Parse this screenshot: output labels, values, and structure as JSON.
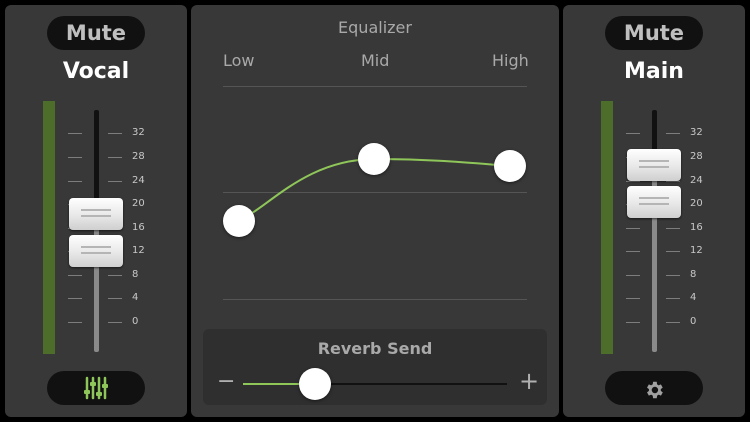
{
  "left_channel": {
    "mute_label": "Mute",
    "name": "Vocal",
    "scale": [
      "32",
      "28",
      "24",
      "20",
      "16",
      "12",
      "8",
      "4",
      "0"
    ],
    "bottom_icon": "mixer-sliders-icon"
  },
  "equalizer": {
    "title": "Equalizer",
    "bands": [
      "Low",
      "Mid",
      "High"
    ],
    "curve_color": "#8fc65a"
  },
  "reverb": {
    "title": "Reverb Send",
    "minus": "−",
    "plus": "+",
    "value": 0.27
  },
  "right_channel": {
    "mute_label": "Mute",
    "name": "Main",
    "scale": [
      "32",
      "28",
      "24",
      "20",
      "16",
      "12",
      "8",
      "4",
      "0"
    ],
    "bottom_icon": "gear-icon"
  },
  "colors": {
    "accent_green": "#8fc65a",
    "meter_green": "#4d6d2a",
    "panel": "#383838"
  }
}
